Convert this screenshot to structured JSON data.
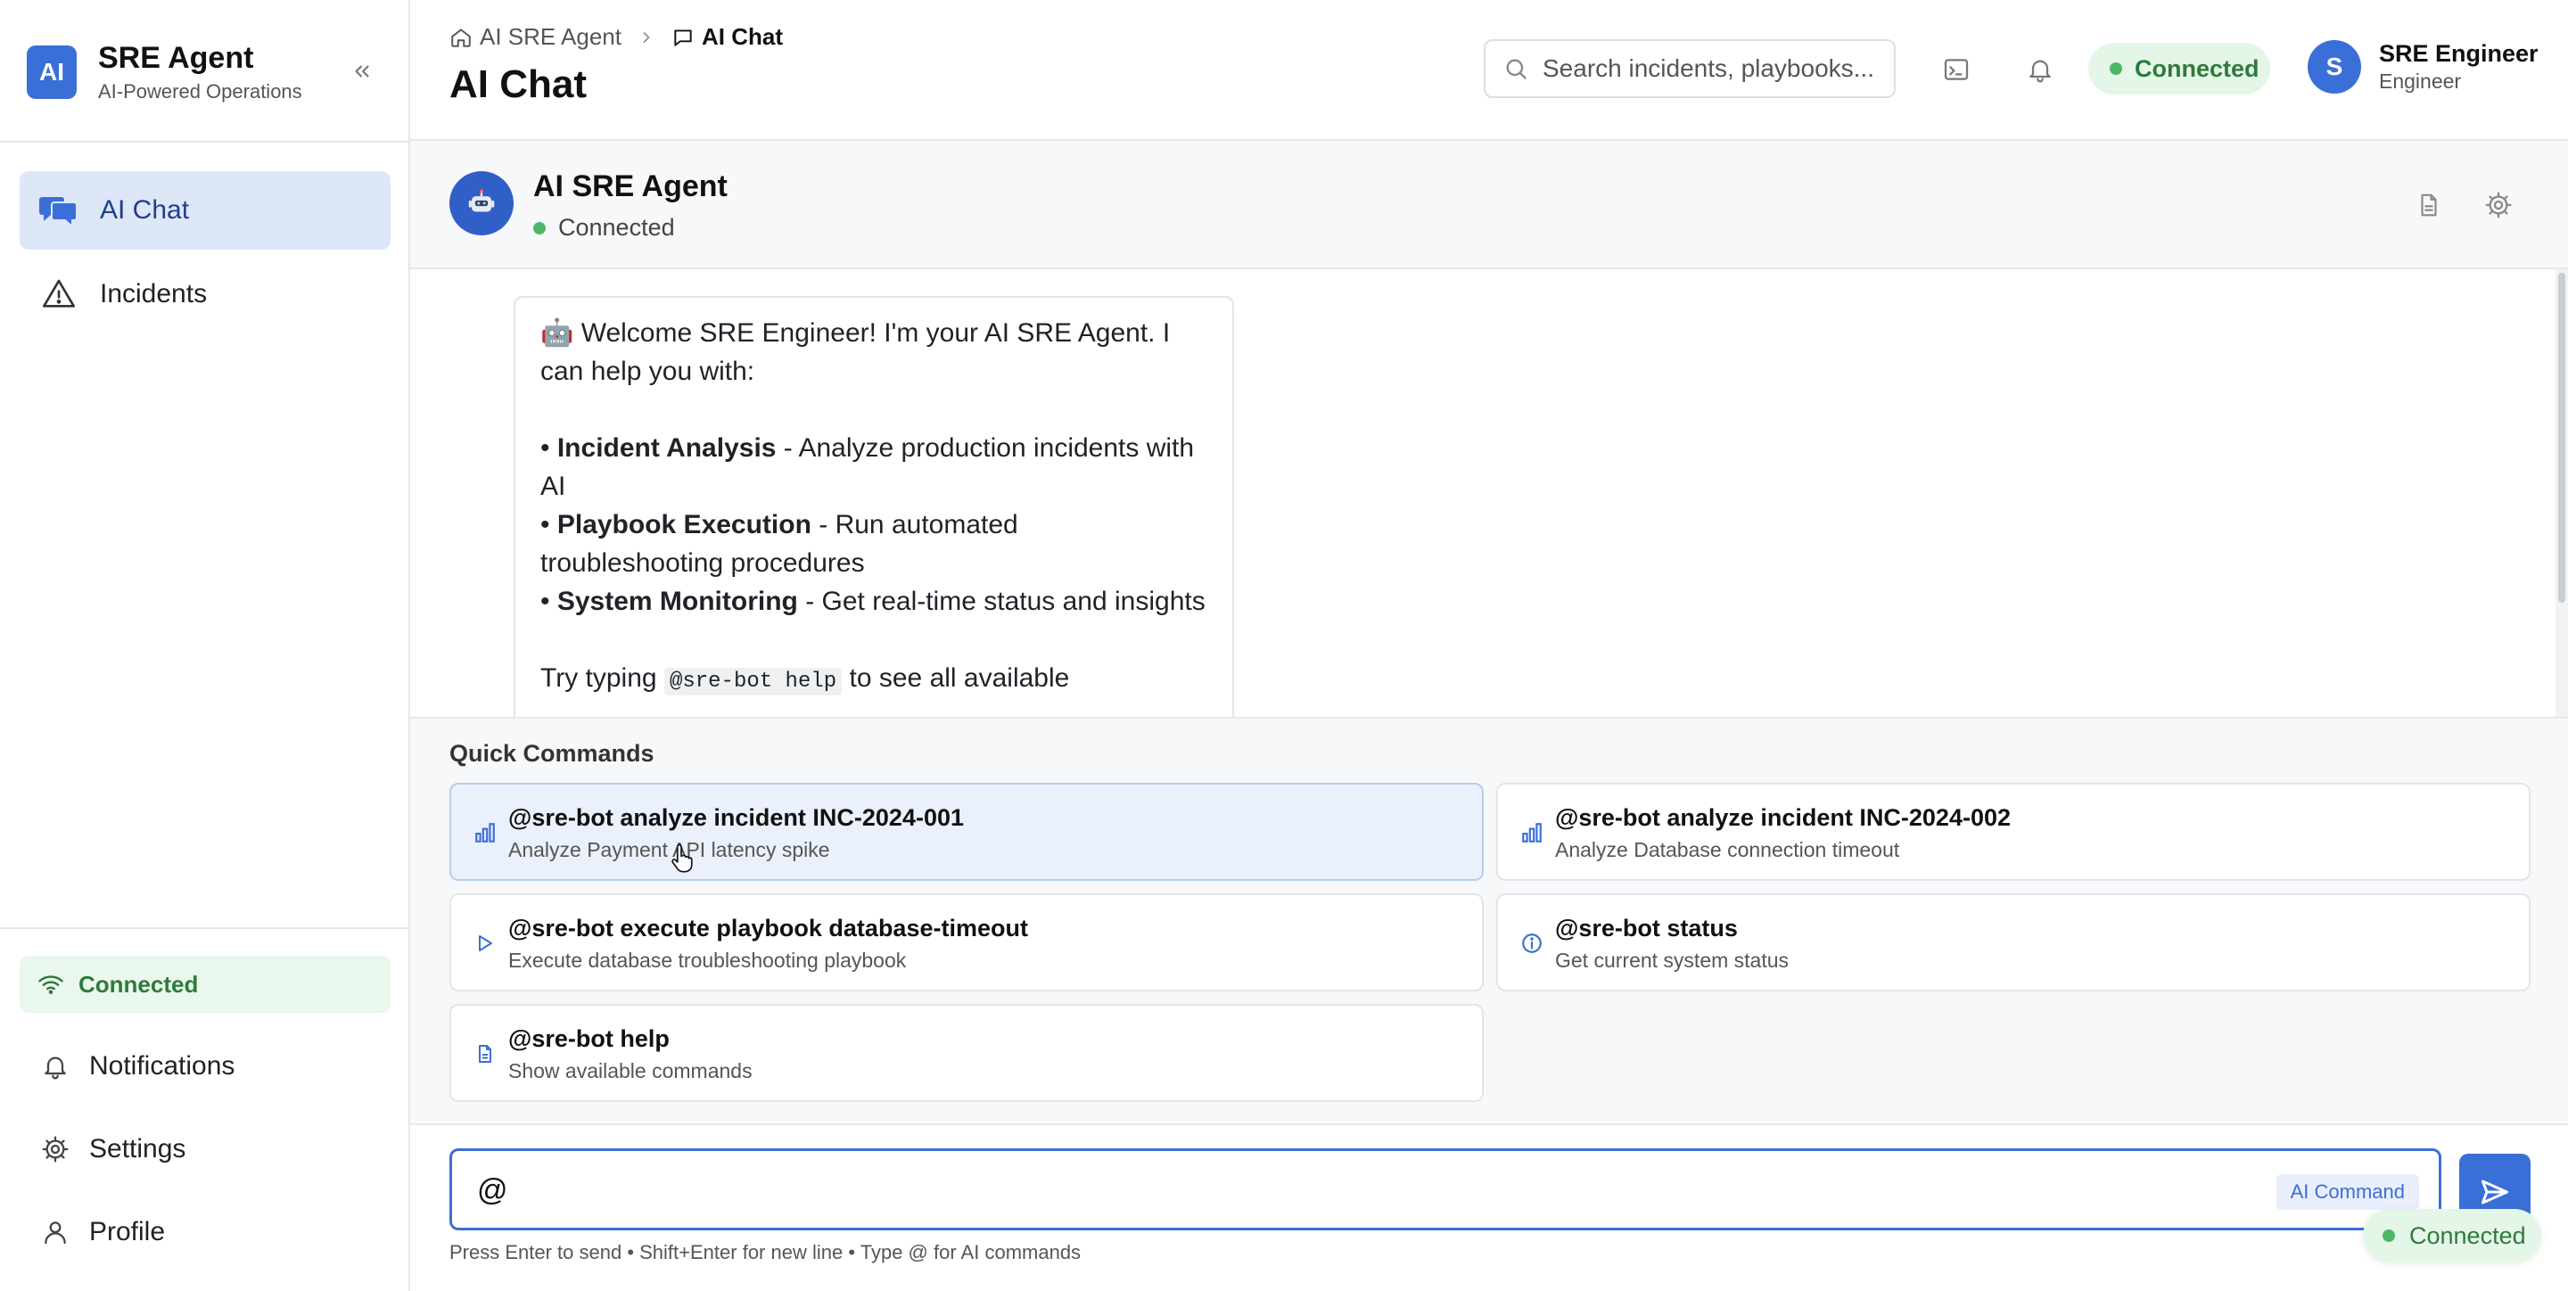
{
  "brand": {
    "logo": "AI",
    "title": "SRE Agent",
    "subtitle": "AI-Powered Operations"
  },
  "sidebar": {
    "items": [
      {
        "label": "AI Chat",
        "icon": "chat-icon",
        "active": true
      },
      {
        "label": "Incidents",
        "icon": "warning-icon",
        "active": false
      }
    ],
    "status": "Connected",
    "bottom_links": [
      {
        "label": "Notifications",
        "icon": "bell-icon"
      },
      {
        "label": "Settings",
        "icon": "gear-icon"
      },
      {
        "label": "Profile",
        "icon": "user-icon"
      }
    ]
  },
  "header": {
    "breadcrumb": [
      "AI SRE Agent",
      "AI Chat"
    ],
    "title": "AI Chat",
    "search_placeholder": "Search incidents, playbooks...",
    "connection": "Connected",
    "user": {
      "initial": "S",
      "name": "SRE Engineer",
      "role": "Engineer"
    }
  },
  "chat": {
    "agent_name": "AI SRE Agent",
    "agent_status": "Connected",
    "welcome": {
      "intro": "🤖 Welcome SRE Engineer! I'm your AI SRE Agent. I can help you with:",
      "items": [
        {
          "bold": "Incident Analysis",
          "text": " - Analyze production incidents with AI"
        },
        {
          "bold": "Playbook Execution",
          "text": " - Run automated troubleshooting procedures"
        },
        {
          "bold": "System Monitoring",
          "text": " - Get real-time status and insights"
        }
      ],
      "try_prefix": "Try typing ",
      "try_code": "@sre-bot help",
      "try_suffix": " to see all available"
    }
  },
  "quick_commands": {
    "title": "Quick Commands",
    "items": [
      {
        "cmd": "@sre-bot analyze incident INC-2024-001",
        "desc": "Analyze Payment API latency spike",
        "icon": "bar-chart-icon"
      },
      {
        "cmd": "@sre-bot analyze incident INC-2024-002",
        "desc": "Analyze Database connection timeout",
        "icon": "bar-chart-icon"
      },
      {
        "cmd": "@sre-bot execute playbook database-timeout",
        "desc": "Execute database troubleshooting playbook",
        "icon": "play-icon"
      },
      {
        "cmd": "@sre-bot status",
        "desc": "Get current system status",
        "icon": "info-icon"
      },
      {
        "cmd": "@sre-bot help",
        "desc": "Show available commands",
        "icon": "document-icon"
      }
    ]
  },
  "input": {
    "value": "@",
    "badge": "AI Command",
    "hint": "Press Enter to send • Shift+Enter for new line • Type @ for AI commands"
  },
  "floating_status": "Connected",
  "colors": {
    "accent": "#3b6fd8",
    "success": "#4cb865",
    "success_bg": "#e4f6e7"
  }
}
